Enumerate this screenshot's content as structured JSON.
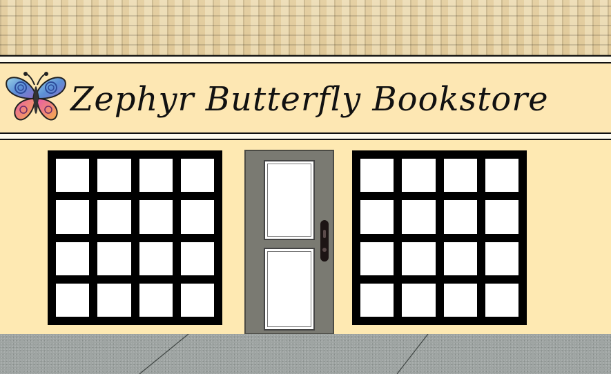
{
  "sign": {
    "text": "Zephyr Butterfly Bookstore"
  },
  "logo": {
    "icon": "butterfly-icon"
  },
  "colors": {
    "wall": "#fee9b2",
    "roof": "#c8b597",
    "door": "#7a7a72",
    "window_frame": "#000000",
    "sidewalk": "#9ea4a2"
  }
}
